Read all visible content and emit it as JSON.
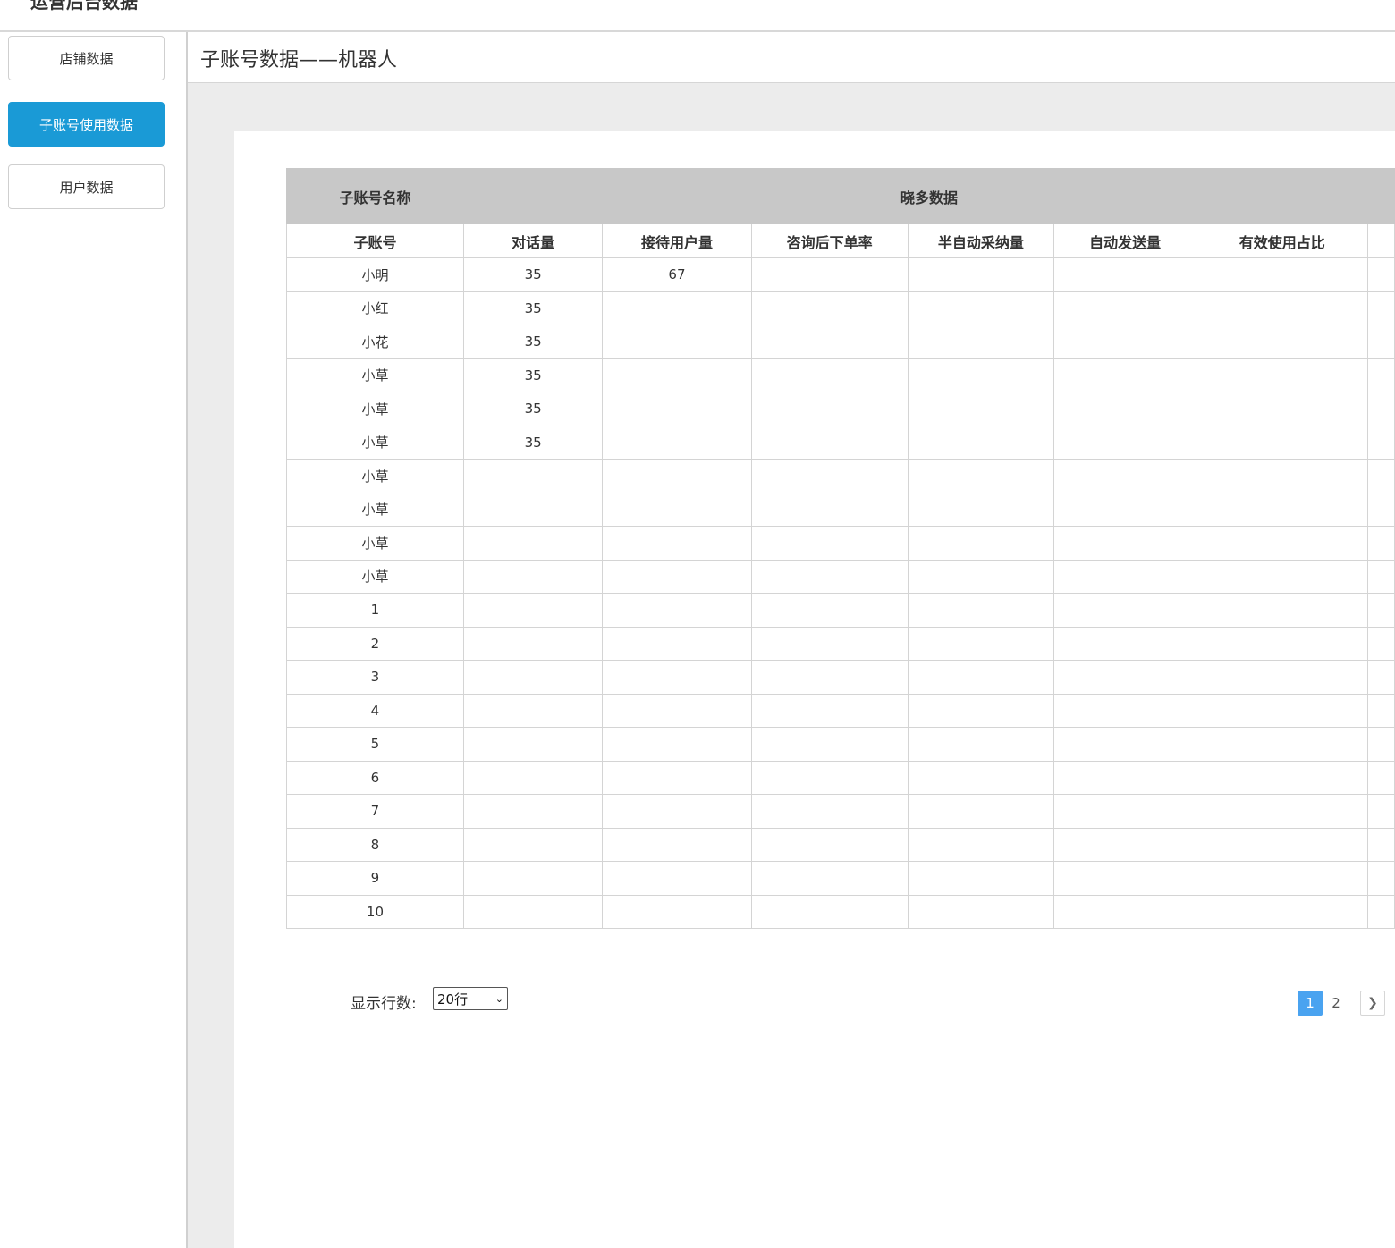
{
  "app": {
    "title": "运营后台数据"
  },
  "sidebar": {
    "items": [
      {
        "label": "店铺数据",
        "active": false
      },
      {
        "label": "子账号使用数据",
        "active": true
      },
      {
        "label": "用户数据",
        "active": false
      }
    ]
  },
  "page": {
    "title": "子账号数据——机器人"
  },
  "table": {
    "group_headers": [
      "子账号名称",
      "晓多数据"
    ],
    "columns": [
      "子账号",
      "对话量",
      "接待用户量",
      "咨询后下单率",
      "半自动采纳量",
      "自动发送量",
      "有效使用占比"
    ],
    "rows": [
      [
        "小明",
        "35",
        "67",
        "",
        "",
        "",
        ""
      ],
      [
        "小红",
        "35",
        "",
        "",
        "",
        "",
        ""
      ],
      [
        "小花",
        "35",
        "",
        "",
        "",
        "",
        ""
      ],
      [
        "小草",
        "35",
        "",
        "",
        "",
        "",
        ""
      ],
      [
        "小草",
        "35",
        "",
        "",
        "",
        "",
        ""
      ],
      [
        "小草",
        "35",
        "",
        "",
        "",
        "",
        ""
      ],
      [
        "小草",
        "",
        "",
        "",
        "",
        "",
        ""
      ],
      [
        "小草",
        "",
        "",
        "",
        "",
        "",
        ""
      ],
      [
        "小草",
        "",
        "",
        "",
        "",
        "",
        ""
      ],
      [
        "小草",
        "",
        "",
        "",
        "",
        "",
        ""
      ],
      [
        "1",
        "",
        "",
        "",
        "",
        "",
        ""
      ],
      [
        "2",
        "",
        "",
        "",
        "",
        "",
        ""
      ],
      [
        "3",
        "",
        "",
        "",
        "",
        "",
        ""
      ],
      [
        "4",
        "",
        "",
        "",
        "",
        "",
        ""
      ],
      [
        "5",
        "",
        "",
        "",
        "",
        "",
        ""
      ],
      [
        "6",
        "",
        "",
        "",
        "",
        "",
        ""
      ],
      [
        "7",
        "",
        "",
        "",
        "",
        "",
        ""
      ],
      [
        "8",
        "",
        "",
        "",
        "",
        "",
        ""
      ],
      [
        "9",
        "",
        "",
        "",
        "",
        "",
        ""
      ],
      [
        "10",
        "",
        "",
        "",
        "",
        "",
        ""
      ]
    ]
  },
  "footer": {
    "rows_label": "显示行数:",
    "rows_select_value": "20行",
    "pages": [
      "1",
      "2"
    ],
    "current_page": "1",
    "next_icon": "chevron-right-icon"
  },
  "colors": {
    "accent": "#1a9ad6",
    "pager_active": "#4aa3f0",
    "header_bg": "#c8c8c8",
    "content_bg": "#ececec"
  }
}
